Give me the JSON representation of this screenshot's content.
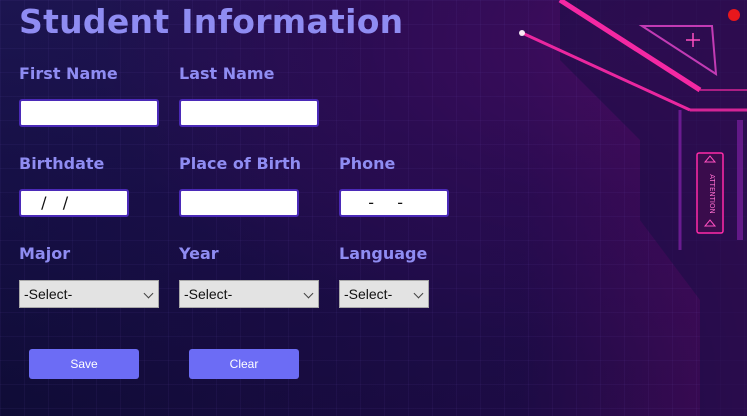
{
  "form": {
    "title": "Student Information",
    "labels": {
      "first_name": "First Name",
      "last_name": "Last Name",
      "birthdate": "Birthdate",
      "place_of_birth": "Place of Birth",
      "phone": "Phone",
      "major": "Major",
      "year": "Year",
      "language": "Language"
    },
    "values": {
      "first_name": "",
      "last_name": "",
      "birthdate": "  /  /",
      "place_of_birth": "",
      "phone": "   -   -"
    },
    "selects": {
      "major": "-Select-",
      "year": "-Select-",
      "language": "-Select-"
    },
    "buttons": {
      "save": "Save",
      "clear": "Clear"
    }
  },
  "decoration": {
    "badge_text": "ATTENTION",
    "plus_glyph": "+"
  },
  "colors": {
    "label": "#8f8cf2",
    "button": "#6c6cf5",
    "accent_pink": "#ff2aa8",
    "background": "#130f3a",
    "record_dot": "#e8171c"
  }
}
